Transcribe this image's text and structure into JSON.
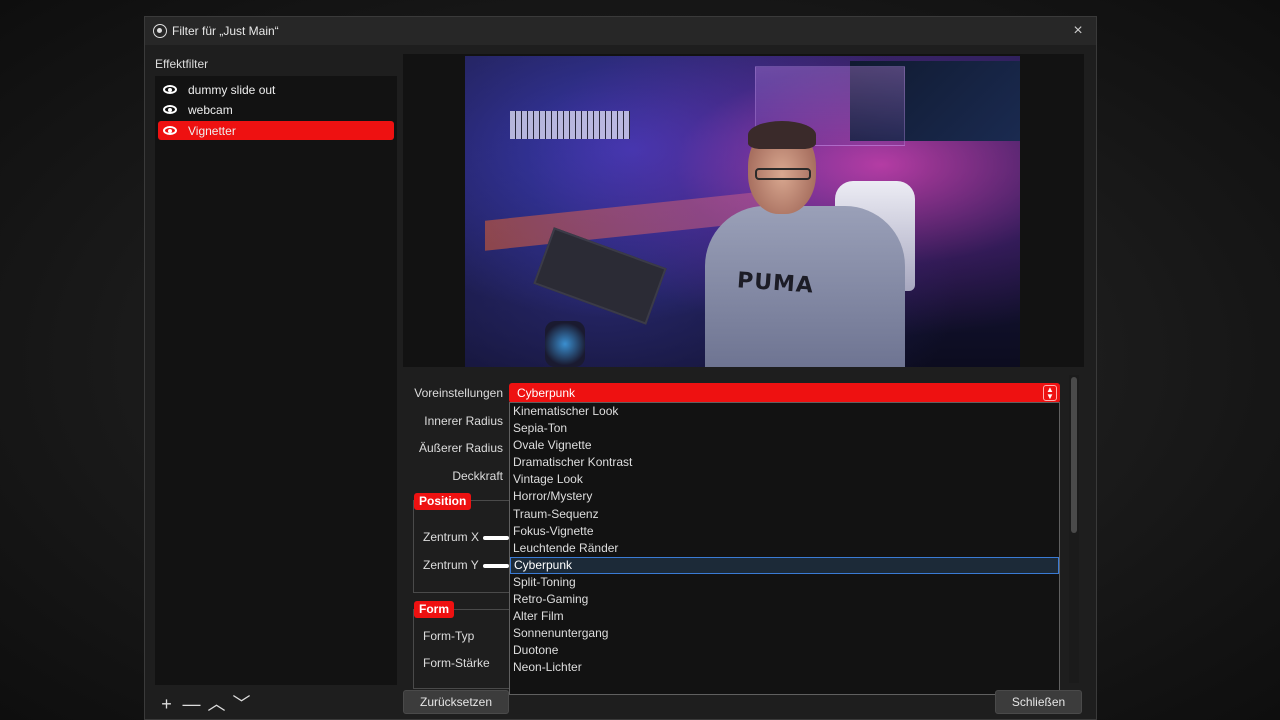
{
  "window": {
    "title": "Filter für „Just Main“",
    "close_icon": "×"
  },
  "effects": {
    "label": "Effektfilter",
    "items": [
      {
        "label": "dummy slide out",
        "visible": true,
        "selected": false
      },
      {
        "label": "webcam",
        "visible": true,
        "selected": false
      },
      {
        "label": "Vignetter",
        "visible": true,
        "selected": true
      }
    ],
    "tools": {
      "add": "+",
      "remove": "—",
      "up": "︿",
      "down": "﹀"
    }
  },
  "preview": {
    "brand_text": "PUMA"
  },
  "properties": {
    "preset_label": "Voreinstellungen",
    "preset_value": "Cyberpunk",
    "inner_radius_label": "Innerer Radius",
    "outer_radius_label": "Äußerer Radius",
    "opacity_label": "Deckkraft",
    "position_group": "Position",
    "center_x_label": "Zentrum X",
    "center_y_label": "Zentrum Y",
    "form_group": "Form",
    "form_type_label": "Form-Typ",
    "form_strength_label": "Form-Stärke"
  },
  "preset_options": [
    "Kinematischer Look",
    "Sepia-Ton",
    "Ovale Vignette",
    "Dramatischer Kontrast",
    "Vintage Look",
    "Horror/Mystery",
    "Traum-Sequenz",
    "Fokus-Vignette",
    "Leuchtende Ränder",
    "Cyberpunk",
    "Split-Toning",
    "Retro-Gaming",
    "Alter Film",
    "Sonnenuntergang",
    "Duotone",
    "Neon-Lichter"
  ],
  "selected_preset_index": 9,
  "buttons": {
    "reset": "Zurücksetzen",
    "close": "Schließen"
  },
  "colors": {
    "accent": "#ee1111",
    "background": "#1e1e1e",
    "selection_border": "#3a7bd5"
  }
}
